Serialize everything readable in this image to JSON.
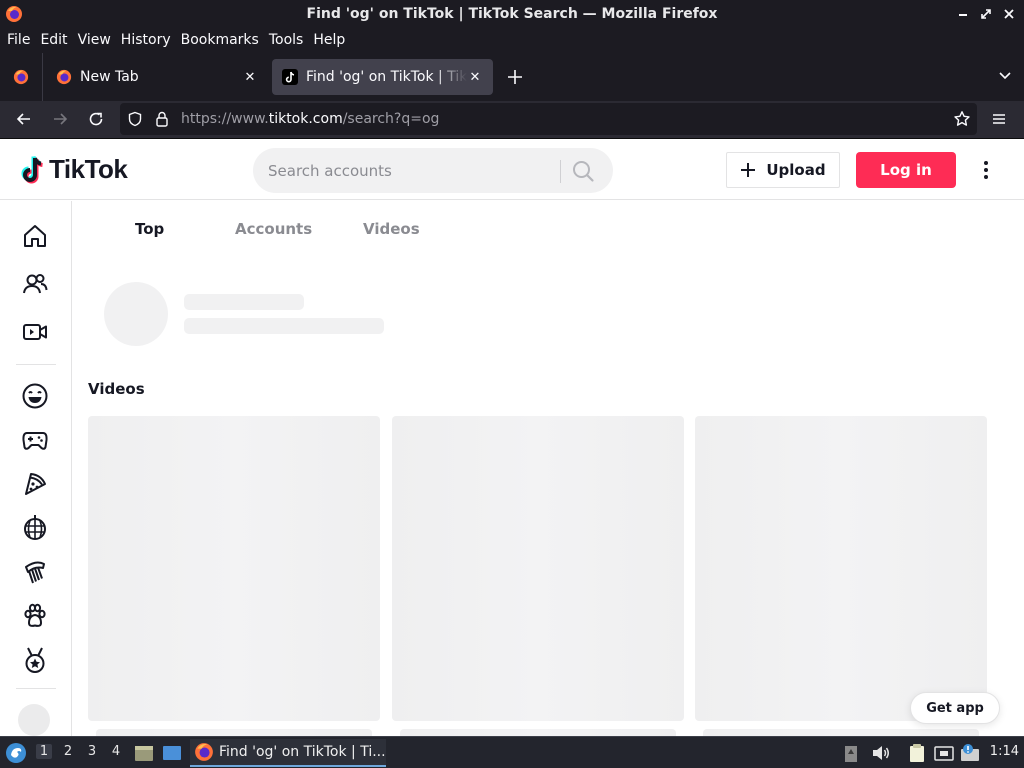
{
  "window": {
    "title": "Find 'og' on TikTok | TikTok Search — Mozilla Firefox"
  },
  "menubar": [
    "File",
    "Edit",
    "View",
    "History",
    "Bookmarks",
    "Tools",
    "Help"
  ],
  "tabs": [
    {
      "label": "New Tab",
      "active": false
    },
    {
      "label": "Find 'og' on TikTok | TikTok Search",
      "active": true
    }
  ],
  "urlbar": {
    "prefix": "https://www.",
    "host": "tiktok.com",
    "path": "/search?q=og"
  },
  "tiktok": {
    "logo_text": "TikTok",
    "search_placeholder": "Search accounts",
    "upload_label": "Upload",
    "login_label": "Log in",
    "brand_color": "#fe2c55",
    "sidebar_icons": [
      "home-icon",
      "following-icon",
      "live-icon",
      "comedy-icon",
      "gaming-icon",
      "food-icon",
      "dance-icon",
      "beauty-icon",
      "animals-icon",
      "sports-icon"
    ],
    "result_tabs": [
      {
        "label": "Top",
        "active": true
      },
      {
        "label": "Accounts",
        "active": false
      },
      {
        "label": "Videos",
        "active": false
      }
    ],
    "videos_heading": "Videos",
    "get_app_label": "Get app"
  },
  "taskbar": {
    "workspaces": [
      "1",
      "2",
      "3",
      "4"
    ],
    "active_workspace": "1",
    "window_label": "Find 'og' on TikTok | Ti...",
    "clock": "1:14"
  }
}
